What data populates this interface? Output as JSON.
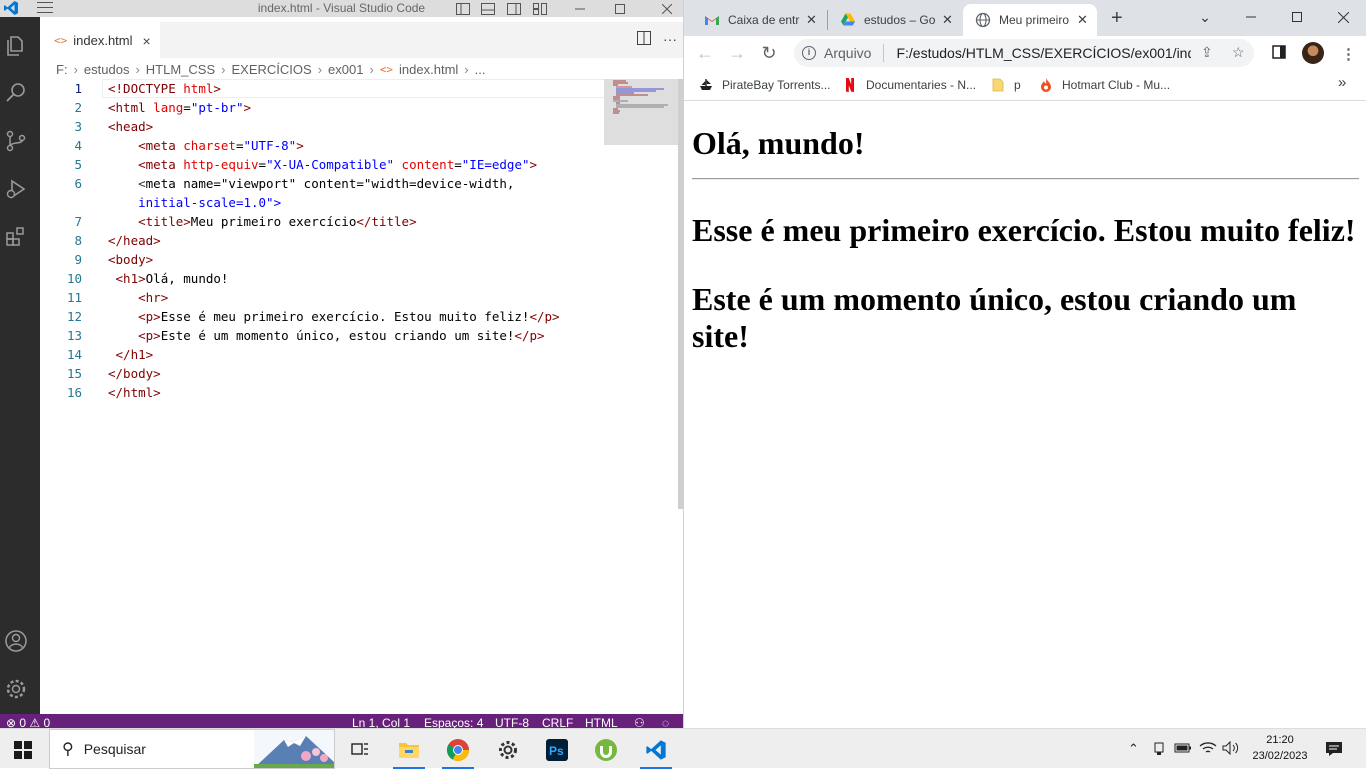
{
  "vscode": {
    "window_title": "index.html - Visual Studio Code",
    "tab": {
      "label": "index.html",
      "icon_glyph": "<>",
      "close": "×"
    },
    "breadcrumb": [
      "F:",
      "estudos",
      "HTLM_CSS",
      "EXERCÍCIOS",
      "ex001",
      "index.html",
      "..."
    ],
    "code_lines": [
      {
        "n": "1",
        "text": "<!DOCTYPE html>"
      },
      {
        "n": "2",
        "text": "<html lang=\"pt-br\">"
      },
      {
        "n": "3",
        "text": "<head>"
      },
      {
        "n": "4",
        "text": "    <meta charset=\"UTF-8\">"
      },
      {
        "n": "5",
        "text": "    <meta http-equiv=\"X-UA-Compatible\" content=\"IE=edge\">"
      },
      {
        "n": "6",
        "text": "    <meta name=\"viewport\" content=\"width=device-width,"
      },
      {
        "n": "",
        "text": "    initial-scale=1.0\">"
      },
      {
        "n": "7",
        "text": "    <title>Meu primeiro exercício</title>"
      },
      {
        "n": "8",
        "text": "</head>"
      },
      {
        "n": "9",
        "text": "<body>"
      },
      {
        "n": "10",
        "text": " <h1>Olá, mundo!"
      },
      {
        "n": "11",
        "text": "    <hr>"
      },
      {
        "n": "12",
        "text": "    <p>Esse é meu primeiro exercício. Estou muito feliz!</p>"
      },
      {
        "n": "13",
        "text": "    <p>Este é um momento único, estou criando um site!</p>"
      },
      {
        "n": "14",
        "text": " </h1>"
      },
      {
        "n": "15",
        "text": "</body>"
      },
      {
        "n": "16",
        "text": "</html>"
      }
    ],
    "status": {
      "problems": "⊗ 0 ⚠ 0",
      "position": "Ln 1, Col 1",
      "spaces": "Espaços: 4",
      "encoding": "UTF-8",
      "eol": "CRLF",
      "language": "HTML"
    },
    "colors": {
      "status_bar": "#68217a",
      "activity_bar": "#2c2c2c"
    }
  },
  "chrome": {
    "tabs": [
      {
        "label": "Caixa de entr",
        "icon": "gmail-icon"
      },
      {
        "label": "estudos – Go",
        "icon": "google-drive-icon"
      },
      {
        "label": "Meu primeiro",
        "icon": "globe-icon"
      }
    ],
    "new_tab": "+",
    "omnibox": {
      "scheme": "Arquivo",
      "url": "F:/estudos/HTLM_CSS/EXERCÍCIOS/ex001/ind..."
    },
    "bookmarks": [
      {
        "label": "PirateBay Torrents...",
        "icon": "piratebay-icon"
      },
      {
        "label": "Documentaries - N...",
        "icon": "netflix-icon"
      },
      {
        "label": "p",
        "icon": "folder-icon"
      },
      {
        "label": "Hotmart Club - Mu...",
        "icon": "hotmart-icon"
      }
    ],
    "more_bookmarks": "»",
    "page": {
      "h1": "Olá, mundo!",
      "p1": "Esse é meu primeiro exercício. Estou muito feliz!",
      "p2": "Este é um momento único, estou criando um site!"
    }
  },
  "taskbar": {
    "search_placeholder": "Pesquisar",
    "time": "21:20",
    "date": "23/02/2023"
  }
}
